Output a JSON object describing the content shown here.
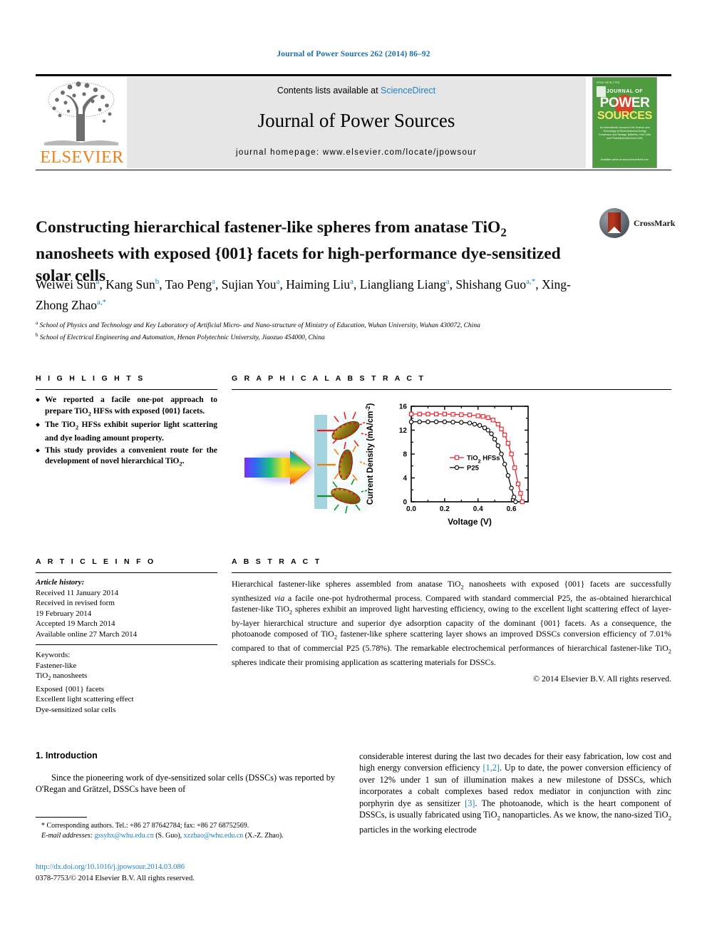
{
  "runhead": "Journal of Power Sources 262 (2014) 86–92",
  "masthead": {
    "contents_prefix": "Contents lists available at ",
    "sciencedirect": "ScienceDirect",
    "journal_name": "Journal of Power Sources",
    "homepage": "journal homepage: www.elsevier.com/locate/jpowsour",
    "elsevier_wordmark": "ELSEVIER",
    "cover": {
      "top_label": "ISSN 0378-7753",
      "journal_of": "JOURNAL OF",
      "power": "POWER",
      "sources": "SOURCES",
      "blurb": "An International Journal on the Science and Technology of Electrochemical Energy Conversion and Storage, Batteries, Fuel Cells and Photoelectrochemical Cells",
      "foot": "Available online at www.sciencedirect.com"
    }
  },
  "article": {
    "title": "Constructing hierarchical fastener-like spheres from anatase TiO₂ nanosheets with exposed {001} facets for high-performance dye-sensitized solar cells",
    "crossmark_label": "CrossMark",
    "authors": [
      {
        "name": "Weiwei Sun",
        "sup": "a"
      },
      {
        "name": "Kang Sun",
        "sup": "b"
      },
      {
        "name": "Tao Peng",
        "sup": "a"
      },
      {
        "name": "Sujian You",
        "sup": "a"
      },
      {
        "name": "Haiming Liu",
        "sup": "a"
      },
      {
        "name": "Liangliang Liang",
        "sup": "a"
      },
      {
        "name": "Shishang Guo",
        "sup": "a,*"
      },
      {
        "name": "Xing-Zhong Zhao",
        "sup": "a,*"
      }
    ],
    "affiliations": [
      {
        "marker": "a",
        "text": "School of Physics and Technology and Key Laboratory of Artificial Micro- and Nano-structure of Ministry of Education, Wuhan University, Wuhan 430072, China"
      },
      {
        "marker": "b",
        "text": "School of Electrical Engineering and Automation, Henan Polytechnic University, Jiaozuo 454000, China"
      }
    ]
  },
  "highlights": {
    "heading": "H I G H L I G H T S",
    "items": [
      "We reported a facile one-pot approach to prepare TiO₂ HFSs with exposed {001} facets.",
      "The TiO₂ HFSs exhibit superior light scattering and dye loading amount property.",
      "This study provides a convenient route for the development of novel hierarchical TiO₂."
    ]
  },
  "graphical_abstract": {
    "heading": "G R A P H I C A L  A B S T R A C T"
  },
  "article_info": {
    "heading": "A R T I C L E  I N F O",
    "history_label": "Article history:",
    "history": [
      "Received 11 January 2014",
      "Received in revised form",
      "19 February 2014",
      "Accepted 19 March 2014",
      "Available online 27 March 2014"
    ],
    "keywords_label": "Keywords:",
    "keywords": [
      "Fastener-like",
      "TiO₂ nanosheets",
      "Exposed {001} facets",
      "Excellent light scattering effect",
      "Dye-sensitized solar cells"
    ]
  },
  "abstract": {
    "heading": "A B S T R A C T",
    "text": "Hierarchical fastener-like spheres assembled from anatase TiO₂ nanosheets with exposed {001} facets are successfully synthesized via a facile one-pot hydrothermal process. Compared with standard commercial P25, the as-obtained hierarchical fastener-like TiO₂ spheres exhibit an improved light harvesting efficiency, owing to the excellent light scattering effect of layer-by-layer hierarchical structure and superior dye adsorption capacity of the dominant {001} facets. As a consequence, the photoanode composed of TiO₂ fastener-like sphere scattering layer shows an improved DSSCs conversion efficiency of 7.01% compared to that of commercial P25 (5.78%). The remarkable electrochemical performances of hierarchical fastener-like TiO₂ spheres indicate their promising application as scattering materials for DSSCs.",
    "copyright": "© 2014 Elsevier B.V. All rights reserved."
  },
  "body": {
    "section_number_title": "1. Introduction",
    "left_paragraph": "Since the pioneering work of dye-sensitized solar cells (DSSCs) was reported by O'Regan and Grätzel, DSSCs have been of",
    "right_paragraph_1": "considerable interest during the last two decades for their easy fabrication, low cost and high energy conversion efficiency ",
    "right_ref_1": "[1,2]",
    "right_paragraph_2": ". Up to date, the power conversion efficiency of over 12% under 1 sun of illumination makes a new milestone of DSSCs, which incorporates a cobalt complexes based redox mediator in conjunction with zinc porphyrin dye as sensitizer ",
    "right_ref_2": "[3]",
    "right_paragraph_3": ". The photoanode, which is the heart component of DSSCs, is usually fabricated using TiO₂ nanoparticles. As we know, the nano-sized TiO₂ particles in the working electrode"
  },
  "footnote": {
    "corresponding": "* Corresponding authors. Tel.: +86 27 87642784; fax: +86 27 68752569.",
    "email_label": "E-mail addresses:",
    "email_1": "gssyhx@whu.edu.cn",
    "email_1_who": "(S. Guo),",
    "email_2": "xzzhao@whu.edu.cn",
    "email_2_who": "(X.-Z. Zhao).",
    "doi": "http://dx.doi.org/10.1016/j.jpowsour.2014.03.086",
    "issn": "0378-7753/© 2014 Elsevier B.V. All rights reserved."
  },
  "chart_data": {
    "type": "line",
    "title": "",
    "xlabel": "Voltage (V)",
    "ylabel": "Current Density (mA/cm²)",
    "xlim": [
      0.0,
      0.7
    ],
    "ylim": [
      0,
      16
    ],
    "xticks": [
      "0.0",
      "0.2",
      "0.4",
      "0.6"
    ],
    "yticks": [
      "0",
      "4",
      "8",
      "12",
      "16"
    ],
    "grid": false,
    "legend_position": "center",
    "series": [
      {
        "name": "TiO₂ HFSs",
        "color": "#ee1c25",
        "marker": "open-square",
        "x": [
          0.0,
          0.05,
          0.1,
          0.15,
          0.2,
          0.25,
          0.3,
          0.35,
          0.4,
          0.43,
          0.46,
          0.49,
          0.52,
          0.54,
          0.56,
          0.58,
          0.6,
          0.62,
          0.64,
          0.655,
          0.665
        ],
        "y": [
          14.7,
          14.7,
          14.7,
          14.7,
          14.7,
          14.65,
          14.6,
          14.55,
          14.4,
          14.3,
          14.1,
          13.7,
          13.0,
          12.2,
          11.2,
          9.8,
          8.0,
          5.7,
          3.0,
          1.4,
          0.0
        ]
      },
      {
        "name": "P25",
        "color": "#000000",
        "marker": "open-circle",
        "x": [
          0.0,
          0.05,
          0.1,
          0.15,
          0.2,
          0.25,
          0.3,
          0.35,
          0.38,
          0.41,
          0.44,
          0.46,
          0.48,
          0.5,
          0.52,
          0.54,
          0.56,
          0.58,
          0.6,
          0.615,
          0.625
        ],
        "y": [
          13.4,
          13.4,
          13.4,
          13.4,
          13.4,
          13.35,
          13.3,
          13.2,
          13.0,
          12.8,
          12.4,
          12.0,
          11.4,
          10.5,
          9.4,
          8.0,
          6.3,
          4.4,
          2.3,
          0.8,
          0.0
        ]
      }
    ]
  }
}
